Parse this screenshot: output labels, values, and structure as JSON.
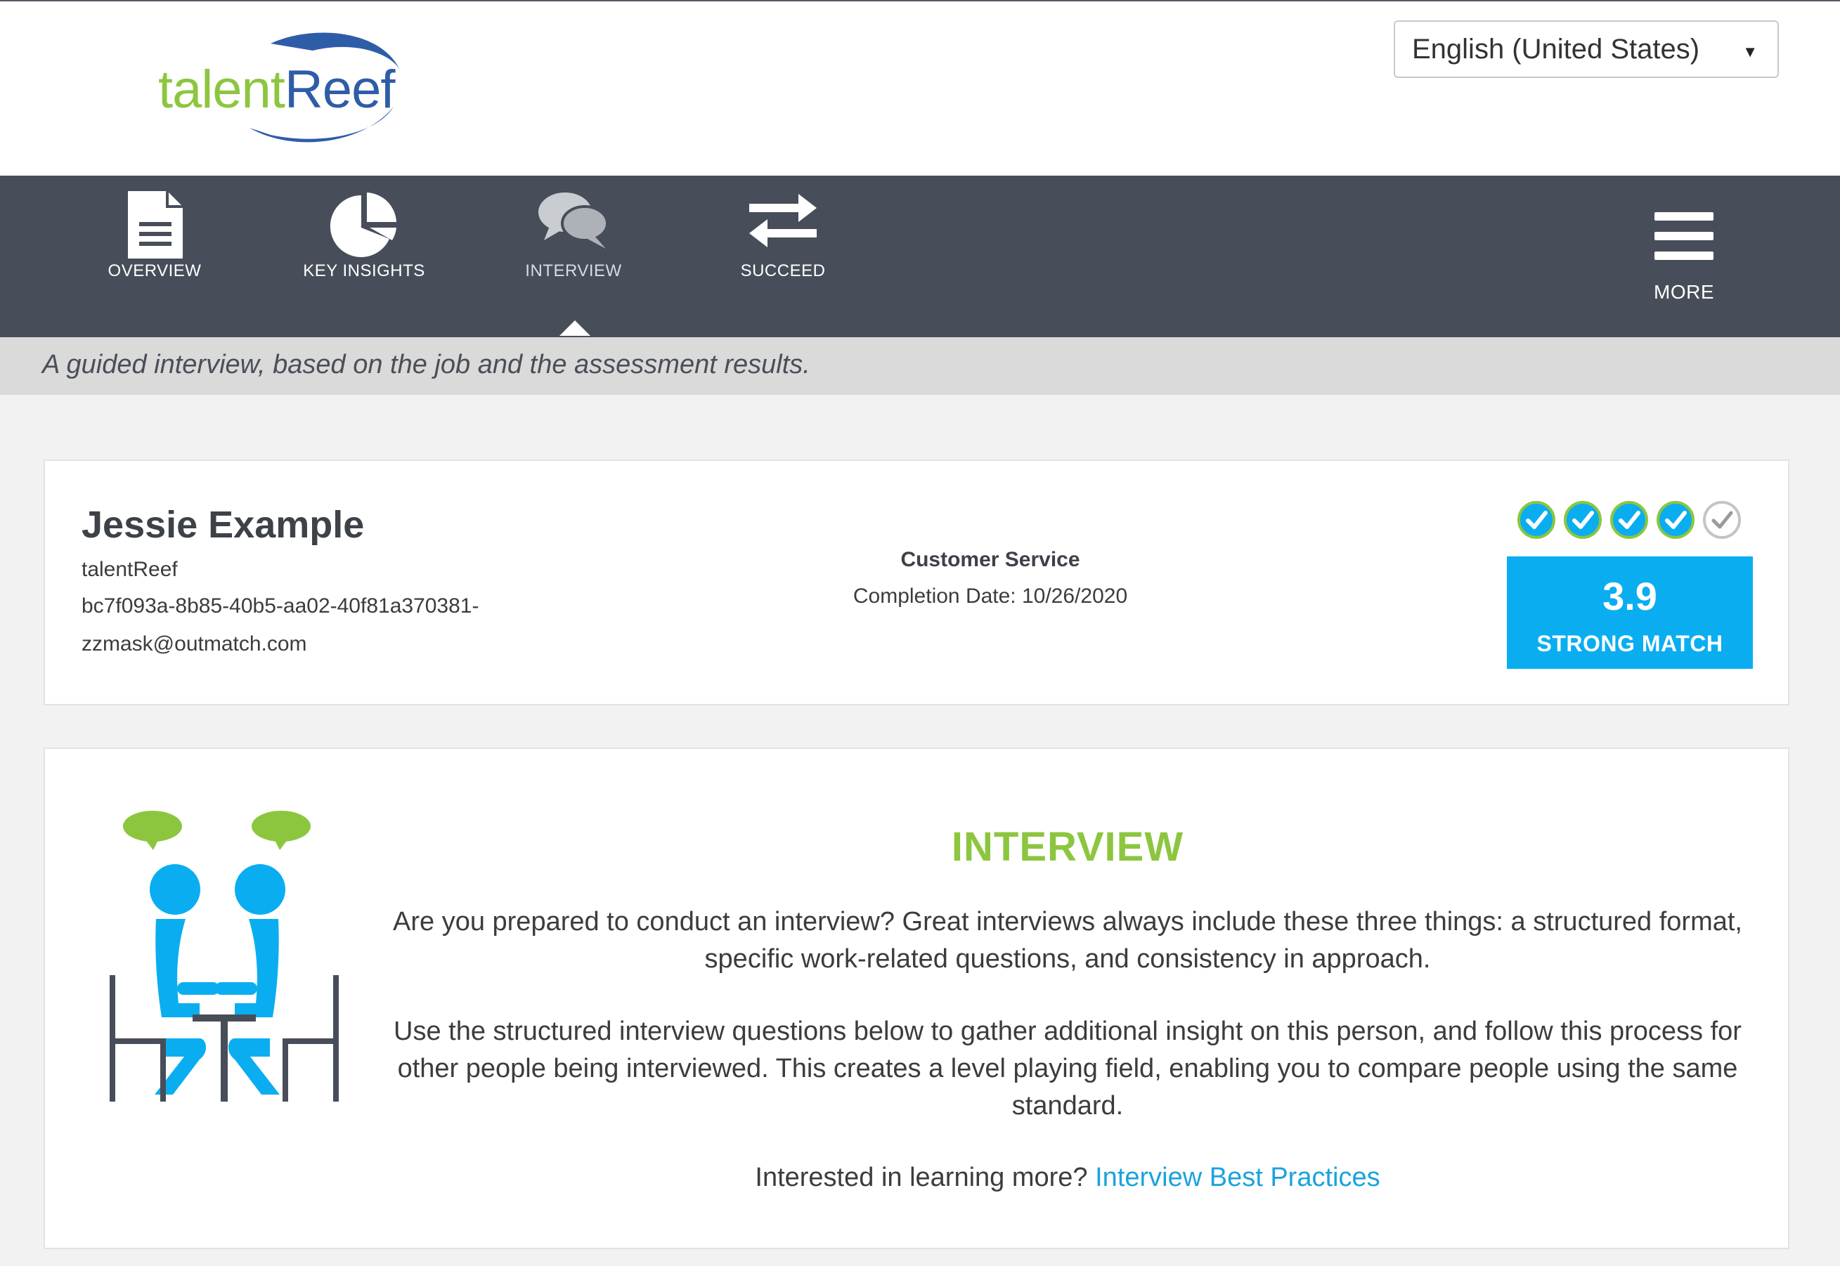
{
  "brand": {
    "logo_part1": "talent",
    "logo_part2": "Reef",
    "colors": {
      "green": "#8cc63f",
      "blue": "#2e5da8",
      "accent": "#0aaef0",
      "nav": "#474e59"
    }
  },
  "language": {
    "selected": "English (United States)",
    "caret": "▼"
  },
  "nav": {
    "items": [
      {
        "label": "OVERVIEW",
        "icon": "document-icon"
      },
      {
        "label": "KEY INSIGHTS",
        "icon": "pie-chart-icon"
      },
      {
        "label": "INTERVIEW",
        "icon": "chat-bubbles-icon",
        "active": true
      },
      {
        "label": "SUCCEED",
        "icon": "swap-arrows-icon"
      }
    ],
    "more": {
      "label": "MORE",
      "icon": "hamburger-icon"
    }
  },
  "tagline": "A guided interview, based on the job and the assessment results.",
  "candidate": {
    "name": "Jessie Example",
    "company": "talentReef",
    "id_line": "bc7f093a-8b85-40b5-aa02-40f81a370381-",
    "email": "zzmask@outmatch.com",
    "job_title": "Customer Service",
    "completion": "Completion Date: 10/26/2020",
    "rating": {
      "filled": 4,
      "total": 5
    },
    "score": "3.9",
    "match_label": "STRONG MATCH"
  },
  "interview": {
    "title": "INTERVIEW",
    "para1": "Are you prepared to conduct an interview? Great interviews always include these three things: a structured format, specific work-related questions, and consistency in approach.",
    "para2": "Use the structured interview questions below to gather additional insight on this person, and follow this process for other people being interviewed. This creates a level playing field, enabling you to compare people using the same standard.",
    "learn_more_prefix": "Interested in learning more?",
    "learn_more_link": "Interview Best Practices"
  }
}
